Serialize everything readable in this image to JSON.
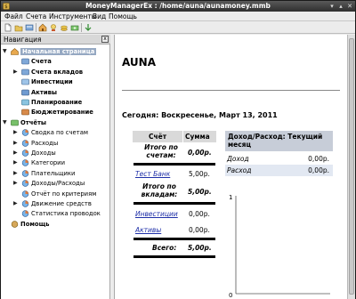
{
  "window": {
    "title": "MoneyManagerEx : /home/auna/aunamoney.mmb",
    "controls": {
      "minimize": "▾",
      "maximize": "▴",
      "close": "✕"
    }
  },
  "menubar": [
    "Файл",
    "Счета",
    "Инструменты",
    "Вид",
    "Помощь"
  ],
  "toolbar": {
    "icons": [
      "new-file-icon",
      "open-folder-icon",
      "accounts-icon",
      "home-icon",
      "wizard-icon",
      "coins-icon",
      "cash-icon",
      "filter-icon"
    ]
  },
  "navigation": {
    "header": "Навигация",
    "close_label": "x",
    "items": [
      {
        "label": "Начальная страница",
        "bold": true,
        "selected": true,
        "expander": "▼",
        "icon": "home-icon"
      },
      {
        "label": "Счета",
        "bold": true,
        "icon": "bank-icon"
      },
      {
        "label": "Счета вкладов",
        "bold": true,
        "expander": "▶",
        "icon": "bank-icon"
      },
      {
        "label": "Инвестиции",
        "bold": true,
        "icon": "chart-icon"
      },
      {
        "label": "Активы",
        "bold": true,
        "icon": "car-icon"
      },
      {
        "label": "Планирование",
        "bold": true,
        "icon": "calendar-icon"
      },
      {
        "label": "Бюджетирование",
        "bold": true,
        "icon": "budget-icon"
      },
      {
        "label": "Отчёты",
        "bold": true,
        "expander": "▼",
        "icon": "reports-icon"
      },
      {
        "label": "Сводка по счетам",
        "expander": "▶",
        "icon": "pie-chart-icon"
      },
      {
        "label": "Расходы",
        "expander": "▶",
        "icon": "pie-chart-icon"
      },
      {
        "label": "Доходы",
        "expander": "▶",
        "icon": "pie-chart-icon"
      },
      {
        "label": "Категории",
        "expander": "▶",
        "icon": "pie-chart-icon"
      },
      {
        "label": "Плательщики",
        "expander": "▶",
        "icon": "pie-chart-icon"
      },
      {
        "label": "Доходы/Расходы",
        "expander": "▶",
        "icon": "pie-chart-icon"
      },
      {
        "label": "Отчёт по критериям",
        "icon": "pie-chart-icon"
      },
      {
        "label": "Движение средств",
        "expander": "▶",
        "icon": "pie-chart-icon"
      },
      {
        "label": "Статистика проводок",
        "icon": "pie-chart-icon"
      },
      {
        "label": "Помощь",
        "bold": true,
        "icon": "help-icon"
      }
    ]
  },
  "home": {
    "title": "AUNA",
    "date_line": "Сегодня: Воскресенье, Март 13, 2011",
    "accounts": {
      "col_account": "Счёт",
      "col_sum": "Сумма",
      "total_accounts_label": "Итого по счетам:",
      "total_accounts_value": "0,00р.",
      "test_bank_label": "Тест Банк",
      "test_bank_value": "5,00р.",
      "total_deposits_label": "Итого по вкладам:",
      "total_deposits_value": "5,00р.",
      "investments_label": "Инвестиции",
      "investments_value": "0,00р.",
      "assets_label": "Активы",
      "assets_value": "0,00р.",
      "grand_total_label": "Всего:",
      "grand_total_value": "5,00р."
    },
    "income_expense": {
      "header": "Доход/Расход: Текущий месяц",
      "income_label": "Доход",
      "income_value": "0,00р.",
      "expense_label": "Расход",
      "expense_value": "0,00р.",
      "axis_top": "1",
      "axis_bottom": "0"
    }
  },
  "colors": {
    "selection": "#95a8c2",
    "table_header": "#d9d9d9",
    "ie_header": "#c7cdd8",
    "ie_expense_row": "#e2e8f2",
    "link": "#1e2fa8"
  }
}
